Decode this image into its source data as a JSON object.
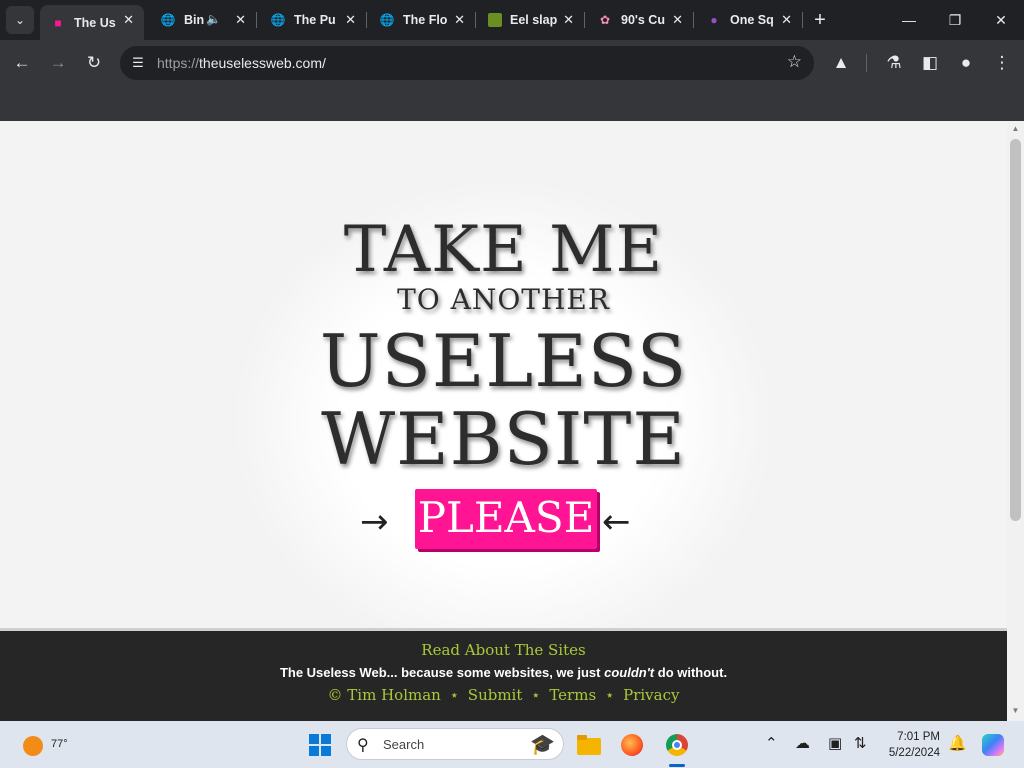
{
  "browser": {
    "tabs": [
      {
        "title": "The Us",
        "favicon": "useless-web-icon",
        "active": true
      },
      {
        "title": "Bin",
        "favicon": "globe-icon",
        "audio": true
      },
      {
        "title": "The Pu",
        "favicon": "globe-icon"
      },
      {
        "title": "The Flo",
        "favicon": "globe-icon"
      },
      {
        "title": "Eel slap",
        "favicon": "eel-icon"
      },
      {
        "title": "90's Cu",
        "favicon": "cursor-icon"
      },
      {
        "title": "One Sq",
        "favicon": "purple-square-icon"
      }
    ],
    "url_scheme": "https://",
    "url_host": "theuselessweb.com/"
  },
  "page": {
    "line1": "TAKE ME",
    "line2": "TO ANOTHER",
    "line3": "USELESS",
    "line4": "WEBSITE",
    "arrow_left": "→",
    "arrow_right": "←",
    "please_label": "PLEASE",
    "accent_color": "#ff1493"
  },
  "footer": {
    "read_link": "Read About The Sites",
    "tagline_a": "The Useless Web... because some websites, we just ",
    "tagline_em": "couldn't",
    "tagline_b": " do without.",
    "copyright": "© Tim Holman",
    "sep": "⋆",
    "submit": "Submit",
    "terms": "Terms",
    "privacy": "Privacy",
    "accent_color": "#a8c93a"
  },
  "taskbar": {
    "temperature": "77°",
    "search_placeholder": "Search",
    "time": "7:01 PM",
    "date": "5/22/2024"
  }
}
